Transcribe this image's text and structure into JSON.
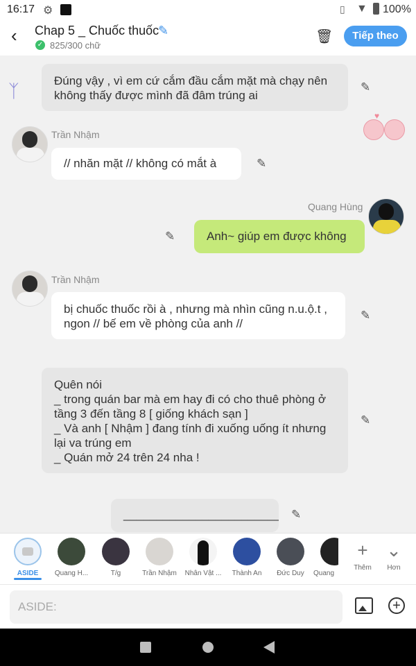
{
  "status": {
    "time": "16:17",
    "battery": "100%"
  },
  "header": {
    "back_icon": "back-arrow-icon",
    "title": "Chap 5 _ Chuốc thuốc",
    "word_count": "825/300 chữ",
    "next_label": "Tiếp theo"
  },
  "messages": [
    {
      "speaker": "",
      "text": "Đúng vậy , vì em cứ cắm đầu cắm mặt mà chạy nên không thấy được mình đã đâm trúng ai"
    },
    {
      "speaker": "Trần Nhậm",
      "text": "// nhăn mặt // không có mắt à"
    },
    {
      "speaker": "Quang Hùng",
      "text": "Anh~ giúp em được không"
    },
    {
      "speaker": "Trần Nhậm",
      "text": "bị chuốc thuốc rồi à , nhưng mà nhìn cũng n.u.ộ.t , ngon // bế em về phòng của anh //"
    },
    {
      "speaker": "",
      "lines": [
        "Quên nói",
        "_ trong quán bar mà em hay đi có cho thuê phòng ở tầng 3 đến tầng 8 [ giống khách sạn ]",
        " _ Và anh [ Nhậm ] đang tính đi xuống uống ít nhưng lại va trúng em",
        "_ Quán mở 24 trên 24 nha !"
      ]
    },
    {
      "speaker": "",
      "text": "________________________"
    }
  ],
  "characters": [
    {
      "label": "ASIDE",
      "active": true
    },
    {
      "label": "Quang H..."
    },
    {
      "label": "T/g"
    },
    {
      "label": "Trần Nhậm"
    },
    {
      "label": "Nhân Vật ..."
    },
    {
      "label": "Thành An"
    },
    {
      "label": "Đức Duy"
    },
    {
      "label": "Quang"
    }
  ],
  "tools": {
    "add_label": "Thêm",
    "more_label": "Hơn"
  },
  "composer": {
    "placeholder": "ASIDE:"
  },
  "colors": {
    "accent": "#4a9ef0",
    "green_bubble": "#c5e97a",
    "chat_bg": "#f1f1f1"
  }
}
